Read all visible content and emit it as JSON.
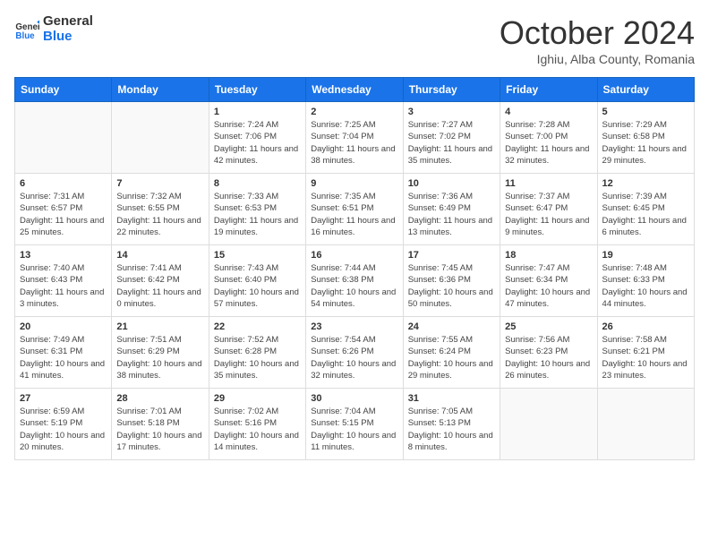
{
  "header": {
    "logo_line1": "General",
    "logo_line2": "Blue",
    "title": "October 2024",
    "subtitle": "Ighiu, Alba County, Romania"
  },
  "weekdays": [
    "Sunday",
    "Monday",
    "Tuesday",
    "Wednesday",
    "Thursday",
    "Friday",
    "Saturday"
  ],
  "weeks": [
    [
      {
        "day": "",
        "info": ""
      },
      {
        "day": "",
        "info": ""
      },
      {
        "day": "1",
        "info": "Sunrise: 7:24 AM\nSunset: 7:06 PM\nDaylight: 11 hours and 42 minutes."
      },
      {
        "day": "2",
        "info": "Sunrise: 7:25 AM\nSunset: 7:04 PM\nDaylight: 11 hours and 38 minutes."
      },
      {
        "day": "3",
        "info": "Sunrise: 7:27 AM\nSunset: 7:02 PM\nDaylight: 11 hours and 35 minutes."
      },
      {
        "day": "4",
        "info": "Sunrise: 7:28 AM\nSunset: 7:00 PM\nDaylight: 11 hours and 32 minutes."
      },
      {
        "day": "5",
        "info": "Sunrise: 7:29 AM\nSunset: 6:58 PM\nDaylight: 11 hours and 29 minutes."
      }
    ],
    [
      {
        "day": "6",
        "info": "Sunrise: 7:31 AM\nSunset: 6:57 PM\nDaylight: 11 hours and 25 minutes."
      },
      {
        "day": "7",
        "info": "Sunrise: 7:32 AM\nSunset: 6:55 PM\nDaylight: 11 hours and 22 minutes."
      },
      {
        "day": "8",
        "info": "Sunrise: 7:33 AM\nSunset: 6:53 PM\nDaylight: 11 hours and 19 minutes."
      },
      {
        "day": "9",
        "info": "Sunrise: 7:35 AM\nSunset: 6:51 PM\nDaylight: 11 hours and 16 minutes."
      },
      {
        "day": "10",
        "info": "Sunrise: 7:36 AM\nSunset: 6:49 PM\nDaylight: 11 hours and 13 minutes."
      },
      {
        "day": "11",
        "info": "Sunrise: 7:37 AM\nSunset: 6:47 PM\nDaylight: 11 hours and 9 minutes."
      },
      {
        "day": "12",
        "info": "Sunrise: 7:39 AM\nSunset: 6:45 PM\nDaylight: 11 hours and 6 minutes."
      }
    ],
    [
      {
        "day": "13",
        "info": "Sunrise: 7:40 AM\nSunset: 6:43 PM\nDaylight: 11 hours and 3 minutes."
      },
      {
        "day": "14",
        "info": "Sunrise: 7:41 AM\nSunset: 6:42 PM\nDaylight: 11 hours and 0 minutes."
      },
      {
        "day": "15",
        "info": "Sunrise: 7:43 AM\nSunset: 6:40 PM\nDaylight: 10 hours and 57 minutes."
      },
      {
        "day": "16",
        "info": "Sunrise: 7:44 AM\nSunset: 6:38 PM\nDaylight: 10 hours and 54 minutes."
      },
      {
        "day": "17",
        "info": "Sunrise: 7:45 AM\nSunset: 6:36 PM\nDaylight: 10 hours and 50 minutes."
      },
      {
        "day": "18",
        "info": "Sunrise: 7:47 AM\nSunset: 6:34 PM\nDaylight: 10 hours and 47 minutes."
      },
      {
        "day": "19",
        "info": "Sunrise: 7:48 AM\nSunset: 6:33 PM\nDaylight: 10 hours and 44 minutes."
      }
    ],
    [
      {
        "day": "20",
        "info": "Sunrise: 7:49 AM\nSunset: 6:31 PM\nDaylight: 10 hours and 41 minutes."
      },
      {
        "day": "21",
        "info": "Sunrise: 7:51 AM\nSunset: 6:29 PM\nDaylight: 10 hours and 38 minutes."
      },
      {
        "day": "22",
        "info": "Sunrise: 7:52 AM\nSunset: 6:28 PM\nDaylight: 10 hours and 35 minutes."
      },
      {
        "day": "23",
        "info": "Sunrise: 7:54 AM\nSunset: 6:26 PM\nDaylight: 10 hours and 32 minutes."
      },
      {
        "day": "24",
        "info": "Sunrise: 7:55 AM\nSunset: 6:24 PM\nDaylight: 10 hours and 29 minutes."
      },
      {
        "day": "25",
        "info": "Sunrise: 7:56 AM\nSunset: 6:23 PM\nDaylight: 10 hours and 26 minutes."
      },
      {
        "day": "26",
        "info": "Sunrise: 7:58 AM\nSunset: 6:21 PM\nDaylight: 10 hours and 23 minutes."
      }
    ],
    [
      {
        "day": "27",
        "info": "Sunrise: 6:59 AM\nSunset: 5:19 PM\nDaylight: 10 hours and 20 minutes."
      },
      {
        "day": "28",
        "info": "Sunrise: 7:01 AM\nSunset: 5:18 PM\nDaylight: 10 hours and 17 minutes."
      },
      {
        "day": "29",
        "info": "Sunrise: 7:02 AM\nSunset: 5:16 PM\nDaylight: 10 hours and 14 minutes."
      },
      {
        "day": "30",
        "info": "Sunrise: 7:04 AM\nSunset: 5:15 PM\nDaylight: 10 hours and 11 minutes."
      },
      {
        "day": "31",
        "info": "Sunrise: 7:05 AM\nSunset: 5:13 PM\nDaylight: 10 hours and 8 minutes."
      },
      {
        "day": "",
        "info": ""
      },
      {
        "day": "",
        "info": ""
      }
    ]
  ]
}
